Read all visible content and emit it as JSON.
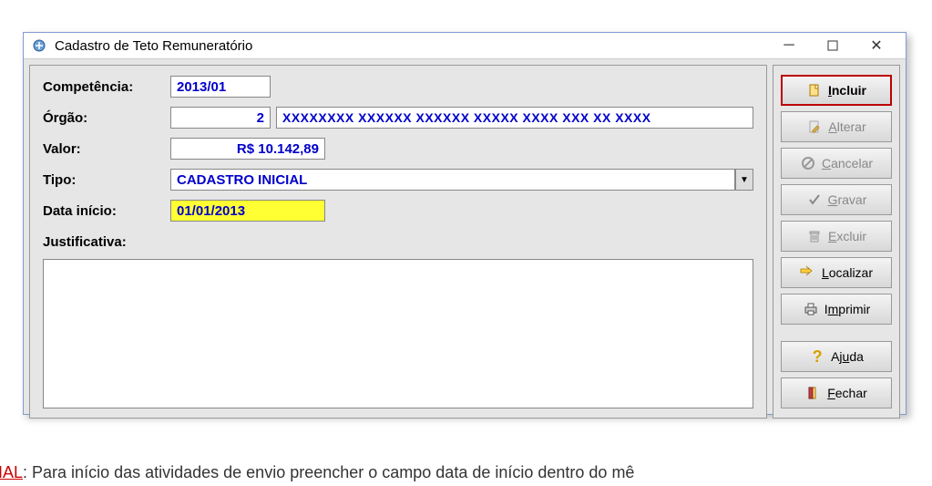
{
  "window": {
    "title": "Cadastro de Teto Remuneratório"
  },
  "labels": {
    "competencia": "Competência:",
    "orgao": "Órgão:",
    "valor": "Valor:",
    "tipo": "Tipo:",
    "data_inicio": "Data início:",
    "justificativa": "Justificativa:"
  },
  "fields": {
    "competencia": "2013/01",
    "orgao_num": "2",
    "orgao_desc": "XXXXXXXX XXXXXX XXXXXX XXXXX XXXX XXX XX XXXX",
    "valor": "R$ 10.142,89",
    "tipo": "CADASTRO INICIAL",
    "data_inicio": "01/01/2013",
    "justificativa": ""
  },
  "buttons": {
    "incluir": "Incluir",
    "alterar": "Alterar",
    "cancelar": "Cancelar",
    "gravar": "Gravar",
    "excluir": "Excluir",
    "localizar": "Localizar",
    "imprimir": "Imprimir",
    "ajuda": "Ajuda",
    "fechar": "Fechar"
  },
  "footer": {
    "prefix_red": "RO INICIAL",
    "text": ": Para início das atividades de envio preencher o campo data de início dentro do mê"
  }
}
